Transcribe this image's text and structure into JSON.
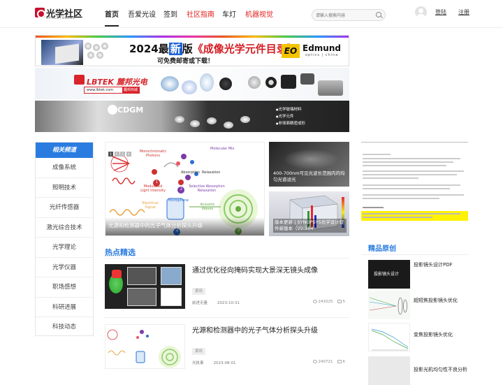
{
  "header": {
    "logo": {
      "main": "光学社区",
      "sub": "OPTICS FORUMS"
    },
    "nav": [
      {
        "label": "首页"
      },
      {
        "label": "吾爱光设"
      },
      {
        "label": "签到"
      },
      {
        "label": "社区指南"
      },
      {
        "label": "车灯"
      },
      {
        "label": "机器视觉"
      }
    ],
    "search_placeholder": "请输入搜索内容",
    "login": "登陆",
    "register": "注册"
  },
  "banners": {
    "edmund": {
      "year": "2024最",
      "new": "新",
      "version": "版",
      "catalog": "《成像光学元件目录》",
      "sub": "可免费邮寄或下载！",
      "eo": "EO",
      "brand": "Edmund",
      "brand_sub": "optics | china"
    },
    "lbtek": {
      "brand": "LBTEK 麓邦光电",
      "url": "www.lbtek.com",
      "url_btn": "麓邦商城"
    },
    "cdgm": {
      "brand": "CDGM",
      "bullets": [
        "光学玻璃材料",
        "光学元件",
        "非球面精密成形"
      ]
    }
  },
  "sidebar": {
    "title": "相关频道",
    "items": [
      "成像系统",
      "照明技术",
      "光纤传感器",
      "激光综合技术",
      "光学理论",
      "光学仪器",
      "职场感想",
      "科研进展",
      "科技动态"
    ]
  },
  "hero": {
    "slides": [
      "1",
      "2",
      "3",
      "4"
    ],
    "caption": "光源和检测器中的光子气体分析探头升级",
    "diagram": {
      "photons": "Monochromatic Photons",
      "mix": "Molecular Mix",
      "absorption": "Absorption",
      "relaxation": "Relaxation",
      "modulated": "Modulated Light Intensity",
      "selective": "Selective Absorption Relaxation",
      "mic": "Microphone",
      "electrical": "Electrical Signal",
      "acoustic": "Acoustic Waves",
      "n1": "1",
      "n2": "2",
      "n3": "3",
      "n4": "4"
    }
  },
  "side_cards": [
    {
      "title": "400-700nm可见光波长范围内的均匀光谱滤光"
    },
    {
      "title": "版本更新丨SYNOPSYS光学设计软件新版本（V2.104"
    }
  ],
  "hot": {
    "title": "热点精选",
    "items": [
      {
        "title": "通过优化径向掩码实现大景深无镜头成像",
        "tag": "资讯",
        "author": "前进无量",
        "date": "2023-10-31",
        "views": "241025",
        "comments": "5"
      },
      {
        "title": "光源和检测器中的光子气体分析探头升级",
        "tag": "资讯",
        "author": "光执事",
        "date": "2023-08-01",
        "views": "240721",
        "comments": "6"
      }
    ]
  },
  "featured": {
    "title": "精品原创",
    "items": [
      {
        "title": "投影镜头设计PDF",
        "thumb": "投影镜头设计"
      },
      {
        "title": "超短焦投影镜头优化"
      },
      {
        "title": "变焦投影镜头优化"
      },
      {
        "title": "投影光机均匀性不良分析"
      }
    ]
  },
  "colors": {
    "accent": "#2b7ce0",
    "red": "#e0201e"
  }
}
